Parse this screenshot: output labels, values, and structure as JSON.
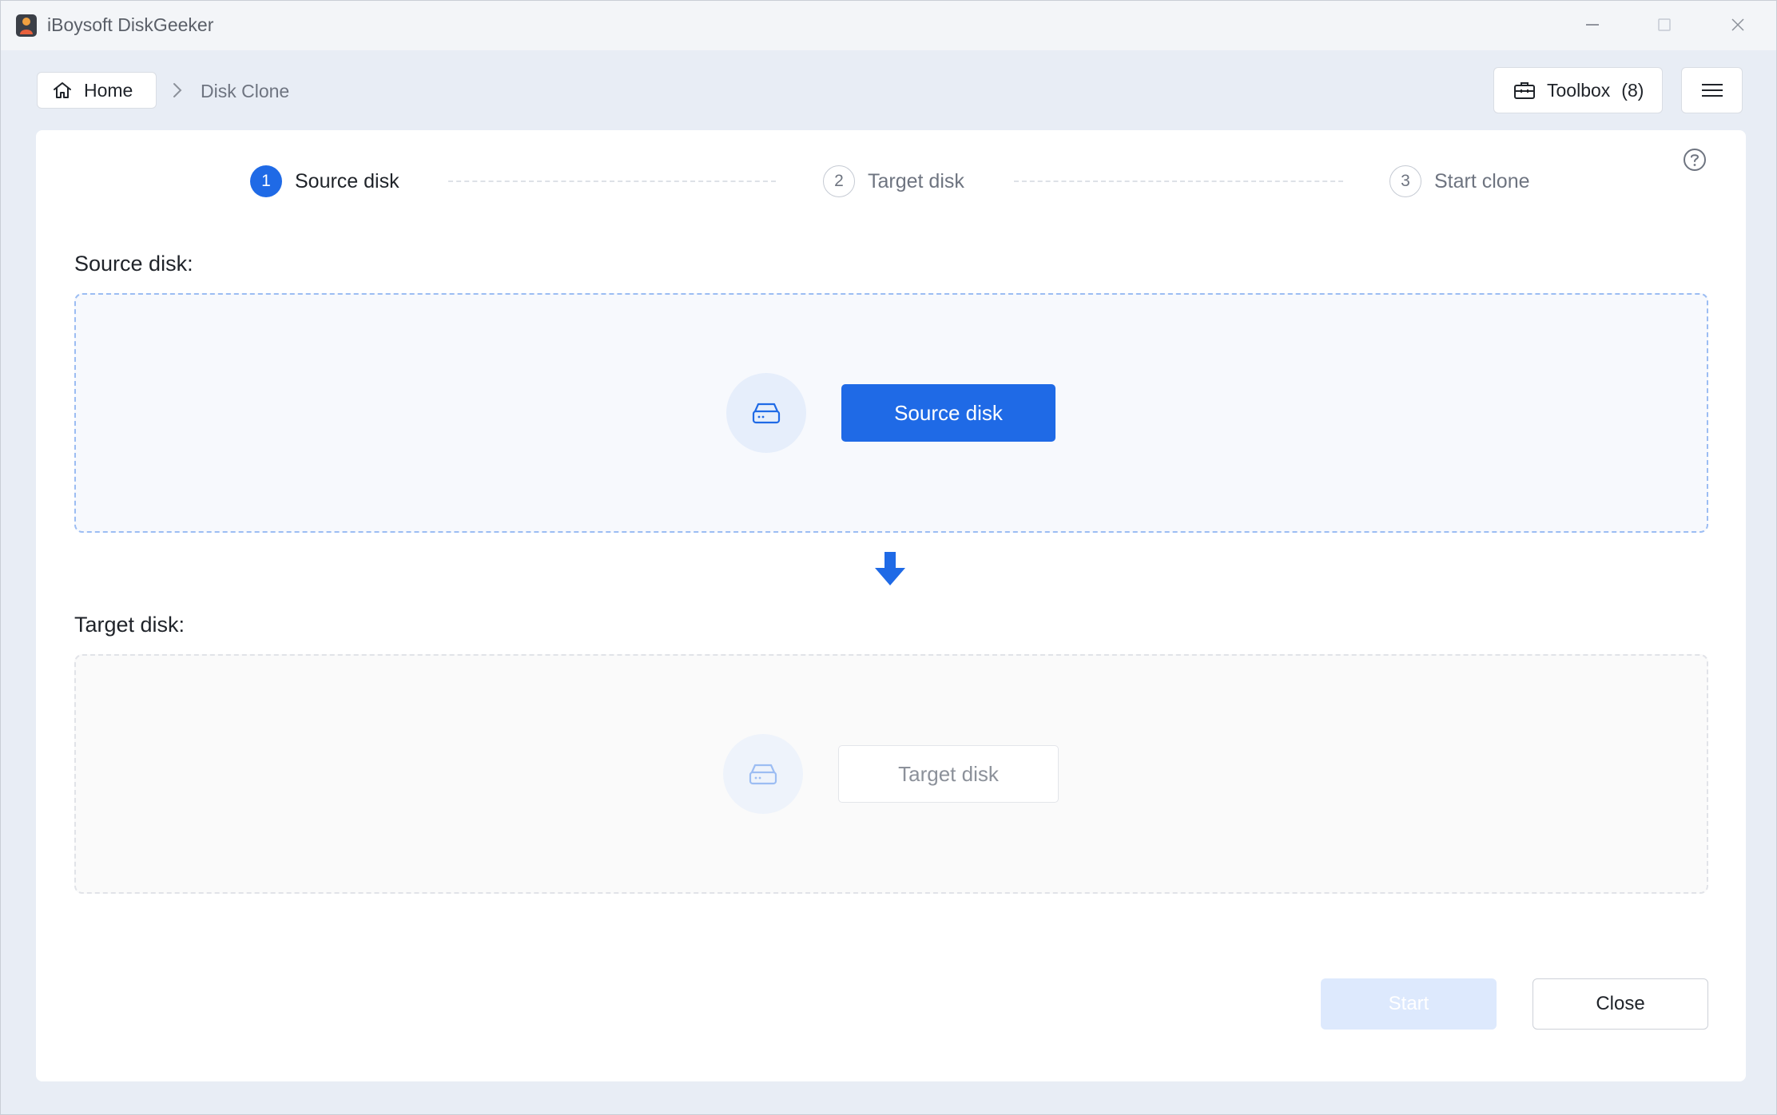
{
  "app": {
    "title": "iBoysoft DiskGeeker"
  },
  "breadcrumb": {
    "home_label": "Home",
    "current": "Disk Clone"
  },
  "header": {
    "toolbox_label": "Toolbox",
    "toolbox_count": "(8)"
  },
  "steps": [
    {
      "number": "1",
      "label": "Source disk",
      "state": "active"
    },
    {
      "number": "2",
      "label": "Target disk",
      "state": "idle"
    },
    {
      "number": "3",
      "label": "Start clone",
      "state": "idle"
    }
  ],
  "source": {
    "section_label": "Source disk:",
    "button_label": "Source disk"
  },
  "target": {
    "section_label": "Target disk:",
    "button_label": "Target disk"
  },
  "actions": {
    "start_label": "Start",
    "close_label": "Close"
  },
  "colors": {
    "accent": "#1f6ae6",
    "disabled_accent": "#dde9fd",
    "background": "#e8edf5"
  },
  "icons": {
    "app": "app-logo-icon",
    "home": "home-icon",
    "breadcrumb_separator": "chevron-right-icon",
    "toolbox": "toolbox-icon",
    "menu": "hamburger-menu-icon",
    "help": "help-circle-icon",
    "disk": "hard-disk-icon",
    "flow": "arrow-down-icon"
  }
}
